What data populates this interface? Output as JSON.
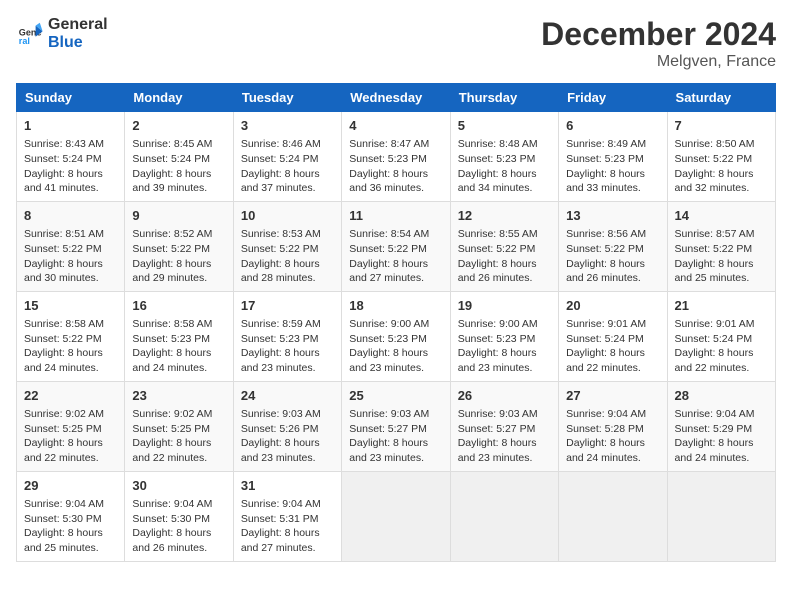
{
  "header": {
    "logo_line1": "General",
    "logo_line2": "Blue",
    "month": "December 2024",
    "location": "Melgven, France"
  },
  "days_of_week": [
    "Sunday",
    "Monday",
    "Tuesday",
    "Wednesday",
    "Thursday",
    "Friday",
    "Saturday"
  ],
  "weeks": [
    [
      {
        "day": "1",
        "sunrise": "Sunrise: 8:43 AM",
        "sunset": "Sunset: 5:24 PM",
        "daylight": "Daylight: 8 hours and 41 minutes."
      },
      {
        "day": "2",
        "sunrise": "Sunrise: 8:45 AM",
        "sunset": "Sunset: 5:24 PM",
        "daylight": "Daylight: 8 hours and 39 minutes."
      },
      {
        "day": "3",
        "sunrise": "Sunrise: 8:46 AM",
        "sunset": "Sunset: 5:24 PM",
        "daylight": "Daylight: 8 hours and 37 minutes."
      },
      {
        "day": "4",
        "sunrise": "Sunrise: 8:47 AM",
        "sunset": "Sunset: 5:23 PM",
        "daylight": "Daylight: 8 hours and 36 minutes."
      },
      {
        "day": "5",
        "sunrise": "Sunrise: 8:48 AM",
        "sunset": "Sunset: 5:23 PM",
        "daylight": "Daylight: 8 hours and 34 minutes."
      },
      {
        "day": "6",
        "sunrise": "Sunrise: 8:49 AM",
        "sunset": "Sunset: 5:23 PM",
        "daylight": "Daylight: 8 hours and 33 minutes."
      },
      {
        "day": "7",
        "sunrise": "Sunrise: 8:50 AM",
        "sunset": "Sunset: 5:22 PM",
        "daylight": "Daylight: 8 hours and 32 minutes."
      }
    ],
    [
      {
        "day": "8",
        "sunrise": "Sunrise: 8:51 AM",
        "sunset": "Sunset: 5:22 PM",
        "daylight": "Daylight: 8 hours and 30 minutes."
      },
      {
        "day": "9",
        "sunrise": "Sunrise: 8:52 AM",
        "sunset": "Sunset: 5:22 PM",
        "daylight": "Daylight: 8 hours and 29 minutes."
      },
      {
        "day": "10",
        "sunrise": "Sunrise: 8:53 AM",
        "sunset": "Sunset: 5:22 PM",
        "daylight": "Daylight: 8 hours and 28 minutes."
      },
      {
        "day": "11",
        "sunrise": "Sunrise: 8:54 AM",
        "sunset": "Sunset: 5:22 PM",
        "daylight": "Daylight: 8 hours and 27 minutes."
      },
      {
        "day": "12",
        "sunrise": "Sunrise: 8:55 AM",
        "sunset": "Sunset: 5:22 PM",
        "daylight": "Daylight: 8 hours and 26 minutes."
      },
      {
        "day": "13",
        "sunrise": "Sunrise: 8:56 AM",
        "sunset": "Sunset: 5:22 PM",
        "daylight": "Daylight: 8 hours and 26 minutes."
      },
      {
        "day": "14",
        "sunrise": "Sunrise: 8:57 AM",
        "sunset": "Sunset: 5:22 PM",
        "daylight": "Daylight: 8 hours and 25 minutes."
      }
    ],
    [
      {
        "day": "15",
        "sunrise": "Sunrise: 8:58 AM",
        "sunset": "Sunset: 5:22 PM",
        "daylight": "Daylight: 8 hours and 24 minutes."
      },
      {
        "day": "16",
        "sunrise": "Sunrise: 8:58 AM",
        "sunset": "Sunset: 5:23 PM",
        "daylight": "Daylight: 8 hours and 24 minutes."
      },
      {
        "day": "17",
        "sunrise": "Sunrise: 8:59 AM",
        "sunset": "Sunset: 5:23 PM",
        "daylight": "Daylight: 8 hours and 23 minutes."
      },
      {
        "day": "18",
        "sunrise": "Sunrise: 9:00 AM",
        "sunset": "Sunset: 5:23 PM",
        "daylight": "Daylight: 8 hours and 23 minutes."
      },
      {
        "day": "19",
        "sunrise": "Sunrise: 9:00 AM",
        "sunset": "Sunset: 5:23 PM",
        "daylight": "Daylight: 8 hours and 23 minutes."
      },
      {
        "day": "20",
        "sunrise": "Sunrise: 9:01 AM",
        "sunset": "Sunset: 5:24 PM",
        "daylight": "Daylight: 8 hours and 22 minutes."
      },
      {
        "day": "21",
        "sunrise": "Sunrise: 9:01 AM",
        "sunset": "Sunset: 5:24 PM",
        "daylight": "Daylight: 8 hours and 22 minutes."
      }
    ],
    [
      {
        "day": "22",
        "sunrise": "Sunrise: 9:02 AM",
        "sunset": "Sunset: 5:25 PM",
        "daylight": "Daylight: 8 hours and 22 minutes."
      },
      {
        "day": "23",
        "sunrise": "Sunrise: 9:02 AM",
        "sunset": "Sunset: 5:25 PM",
        "daylight": "Daylight: 8 hours and 22 minutes."
      },
      {
        "day": "24",
        "sunrise": "Sunrise: 9:03 AM",
        "sunset": "Sunset: 5:26 PM",
        "daylight": "Daylight: 8 hours and 23 minutes."
      },
      {
        "day": "25",
        "sunrise": "Sunrise: 9:03 AM",
        "sunset": "Sunset: 5:27 PM",
        "daylight": "Daylight: 8 hours and 23 minutes."
      },
      {
        "day": "26",
        "sunrise": "Sunrise: 9:03 AM",
        "sunset": "Sunset: 5:27 PM",
        "daylight": "Daylight: 8 hours and 23 minutes."
      },
      {
        "day": "27",
        "sunrise": "Sunrise: 9:04 AM",
        "sunset": "Sunset: 5:28 PM",
        "daylight": "Daylight: 8 hours and 24 minutes."
      },
      {
        "day": "28",
        "sunrise": "Sunrise: 9:04 AM",
        "sunset": "Sunset: 5:29 PM",
        "daylight": "Daylight: 8 hours and 24 minutes."
      }
    ],
    [
      {
        "day": "29",
        "sunrise": "Sunrise: 9:04 AM",
        "sunset": "Sunset: 5:30 PM",
        "daylight": "Daylight: 8 hours and 25 minutes."
      },
      {
        "day": "30",
        "sunrise": "Sunrise: 9:04 AM",
        "sunset": "Sunset: 5:30 PM",
        "daylight": "Daylight: 8 hours and 26 minutes."
      },
      {
        "day": "31",
        "sunrise": "Sunrise: 9:04 AM",
        "sunset": "Sunset: 5:31 PM",
        "daylight": "Daylight: 8 hours and 27 minutes."
      },
      null,
      null,
      null,
      null
    ]
  ]
}
